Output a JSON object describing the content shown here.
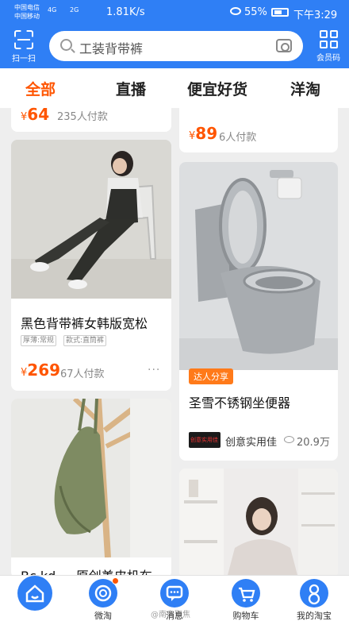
{
  "status_bar": {
    "carrier_1": "中国电信",
    "carrier_2": "中国移动",
    "signal_1": "4G",
    "signal_2": "2G",
    "net_speed": "1.81K/s",
    "battery": "55%",
    "time": "下午3:29"
  },
  "header": {
    "scan_label": "扫一扫",
    "search_text": "工装背带裤",
    "member_label": "会员码",
    "icons": [
      "scan-icon",
      "search-icon",
      "camera-icon",
      "member-code-icon"
    ]
  },
  "tabs": [
    {
      "label": "全部",
      "active": true
    },
    {
      "label": "直播",
      "active": false
    },
    {
      "label": "便宜好货",
      "active": false
    },
    {
      "label": "洋淘",
      "active": false
    }
  ],
  "feed": {
    "col_left": [
      {
        "price_yen": "¥",
        "price": "64",
        "paid": "235人付款"
      },
      {
        "title": "黑色背带裤女韩版宽松",
        "tags": [
          "厚薄:常规",
          "款式:直筒裤"
        ],
        "price_yen": "¥",
        "price": "269",
        "paid": "67人付款",
        "more": "···"
      },
      {
        "title": "Bc kd ... 原创美皮机布"
      }
    ],
    "col_right": [
      {
        "price_yen": "¥",
        "price": "89",
        "paid": "6人付款"
      },
      {
        "badge": "达人分享",
        "title": "圣雪不锈钢坐便器",
        "shop_logo": "创意实用佳",
        "shop": "创意实用佳",
        "views": "20.9万"
      },
      {}
    ]
  },
  "bottom_nav": [
    {
      "label": "",
      "icon": "home-icon"
    },
    {
      "label": "微淘",
      "icon": "weitao-icon"
    },
    {
      "label": "消息",
      "icon": "message-icon"
    },
    {
      "label": "购物车",
      "icon": "cart-icon"
    },
    {
      "label": "我的淘宝",
      "icon": "profile-icon"
    }
  ],
  "watermark": "@南粤聚焦"
}
